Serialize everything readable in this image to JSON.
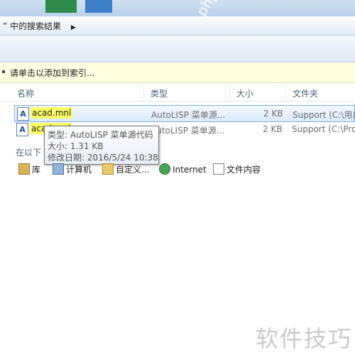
{
  "address": {
    "crumb": "中的搜索结果",
    "lead_quote": "”"
  },
  "infobar": {
    "text": "请单击以添加到索引..."
  },
  "columns": [
    "名称",
    "类型",
    "大小",
    "文件夹"
  ],
  "files": [
    {
      "name": "acad.mnl",
      "type": "AutoLISP 菜单源...",
      "size": "2 KB",
      "folder": "Support (C:\\用户"
    },
    {
      "name": "acad.mnl",
      "type": "AutoLISP 菜单源...",
      "size": "2 KB",
      "folder": "Support (C:\\Pro"
    }
  ],
  "tooltip": {
    "type_line": "类型: AutoLISP 菜单源代码",
    "size_line": "大小: 1.31 KB",
    "date_line": "修改日期: 2016/5/24 10:38"
  },
  "search_again": "在以下",
  "locations": [
    {
      "label": "库",
      "icon": "library-icon"
    },
    {
      "label": "计算机",
      "icon": "computer-icon"
    },
    {
      "label": "自定义...",
      "icon": "custom-folder-icon"
    },
    {
      "label": "Internet",
      "icon": "internet-icon"
    },
    {
      "label": "文件内容",
      "icon": "file-contents-icon"
    }
  ],
  "watermarks": {
    "diagonal": "php中文网",
    "corner": "软件技巧"
  }
}
